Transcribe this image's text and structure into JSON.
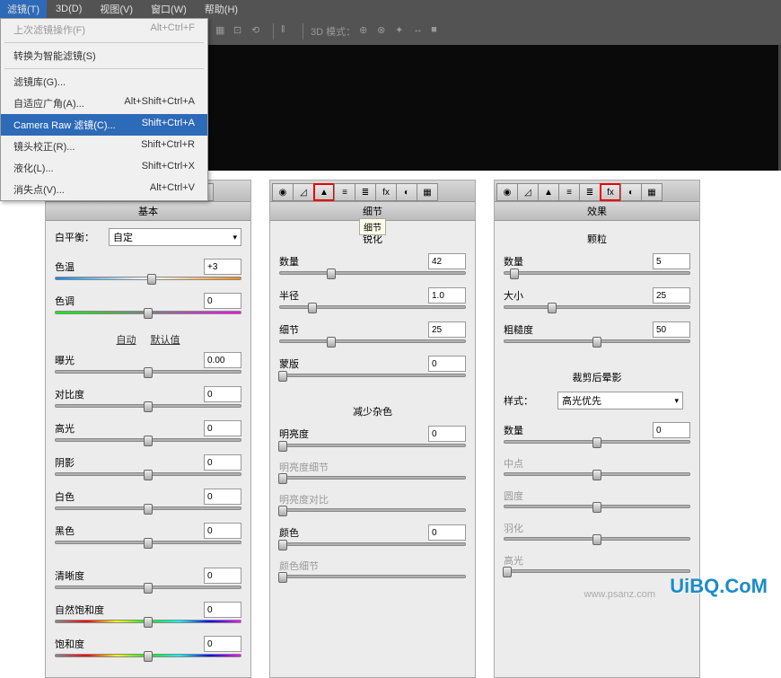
{
  "menubar": {
    "active": "滤镜(T)",
    "items": [
      "3D(D)",
      "视图(V)",
      "窗口(W)",
      "帮助(H)"
    ]
  },
  "dropdown": [
    {
      "l": "上次滤镜操作(F)",
      "r": "Alt+Ctrl+F",
      "dis": true
    },
    {
      "sep": true
    },
    {
      "l": "转换为智能滤镜(S)",
      "r": ""
    },
    {
      "sep": true
    },
    {
      "l": "滤镜库(G)...",
      "r": ""
    },
    {
      "l": "自适应广角(A)...",
      "r": "Alt+Shift+Ctrl+A"
    },
    {
      "l": "Camera Raw 滤镜(C)...",
      "r": "Shift+Ctrl+A",
      "hl": true
    },
    {
      "l": "镜头校正(R)...",
      "r": "Shift+Ctrl+R"
    },
    {
      "l": "液化(L)...",
      "r": "Shift+Ctrl+X"
    },
    {
      "l": "消失点(V)...",
      "r": "Alt+Ctrl+V"
    }
  ],
  "toolbar": {
    "mode_label": "3D 模式："
  },
  "panel1": {
    "title": "基本",
    "tip": "",
    "wb_label": "白平衡：",
    "wb_value": "自定",
    "links": {
      "a": "自动",
      "b": "默认值"
    },
    "sliders": [
      {
        "l": "色温",
        "v": "+3",
        "pos": 52,
        "cls": "rainbow"
      },
      {
        "l": "色调",
        "v": "0",
        "pos": 50,
        "cls": "rainbow2"
      }
    ],
    "exposure": [
      {
        "l": "曝光",
        "v": "0.00",
        "pos": 50
      },
      {
        "l": "对比度",
        "v": "0",
        "pos": 50
      },
      {
        "l": "高光",
        "v": "0",
        "pos": 50
      },
      {
        "l": "阴影",
        "v": "0",
        "pos": 50
      },
      {
        "l": "白色",
        "v": "0",
        "pos": 50
      },
      {
        "l": "黑色",
        "v": "0",
        "pos": 50
      }
    ],
    "clarity": [
      {
        "l": "清晰度",
        "v": "0",
        "pos": 50
      },
      {
        "l": "自然饱和度",
        "v": "0",
        "pos": 50,
        "cls": "sat"
      },
      {
        "l": "饱和度",
        "v": "0",
        "pos": 50,
        "cls": "sat"
      }
    ]
  },
  "panel2": {
    "title": "细节",
    "tip": "细节",
    "sec1": "锐化",
    "sharpen": [
      {
        "l": "数量",
        "v": "42",
        "pos": 28
      },
      {
        "l": "半径",
        "v": "1.0",
        "pos": 18
      },
      {
        "l": "细节",
        "v": "25",
        "pos": 28
      },
      {
        "l": "蒙版",
        "v": "0",
        "pos": 2
      }
    ],
    "sec2": "减少杂色",
    "noise": [
      {
        "l": "明亮度",
        "v": "0",
        "pos": 2
      },
      {
        "l": "明亮度细节",
        "v": "",
        "pos": 2,
        "dis": true
      },
      {
        "l": "明亮度对比",
        "v": "",
        "pos": 2,
        "dis": true
      },
      {
        "l": "颜色",
        "v": "0",
        "pos": 2
      },
      {
        "l": "颜色细节",
        "v": "",
        "pos": 2,
        "dis": true
      }
    ]
  },
  "panel3": {
    "title": "效果",
    "sec1": "颗粒",
    "grain": [
      {
        "l": "数量",
        "v": "5",
        "pos": 6
      },
      {
        "l": "大小",
        "v": "25",
        "pos": 26
      },
      {
        "l": "粗糙度",
        "v": "50",
        "pos": 50
      }
    ],
    "sec2": "裁剪后晕影",
    "style_label": "样式：",
    "style_value": "高光优先",
    "vignette": [
      {
        "l": "数量",
        "v": "0",
        "pos": 50
      },
      {
        "l": "中点",
        "v": "",
        "pos": 50,
        "dis": true
      },
      {
        "l": "圆度",
        "v": "",
        "pos": 50,
        "dis": true
      },
      {
        "l": "羽化",
        "v": "",
        "pos": 50,
        "dis": true
      },
      {
        "l": "高光",
        "v": "",
        "pos": 2,
        "dis": true
      }
    ]
  },
  "watermark": {
    "w1": "UiBQ.CoM",
    "w2": "",
    "url": "www.psanz.com"
  },
  "tabs": {
    "icons": [
      "◉",
      "◿",
      "▲",
      "≡",
      "≣",
      "fx",
      "◐",
      "▦"
    ]
  }
}
